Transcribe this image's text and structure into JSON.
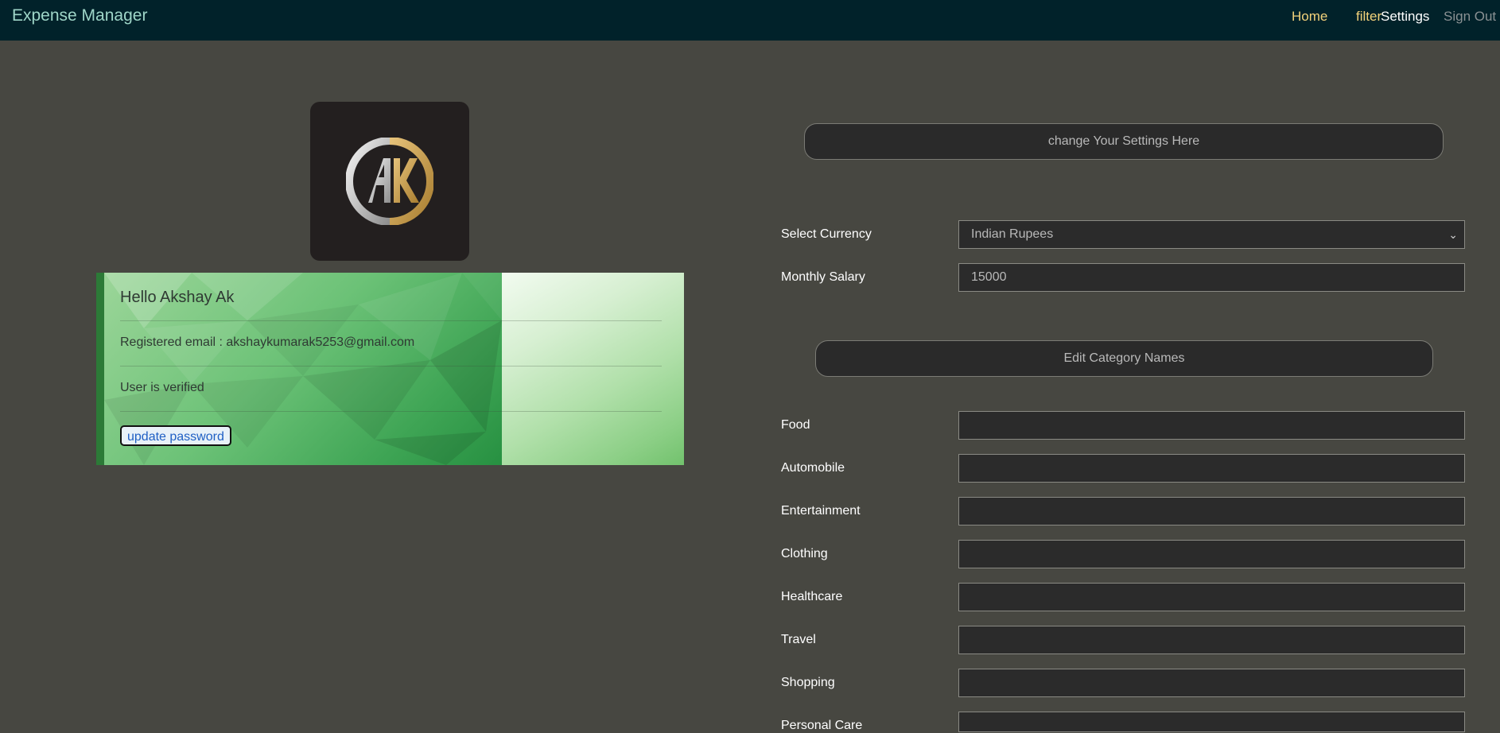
{
  "navbar": {
    "brand": "Expense Manager",
    "links": {
      "home": "Home",
      "filter": "filter",
      "settings": "Settings",
      "signout": "Sign Out"
    }
  },
  "profile": {
    "avatar_icon": "ak-logo",
    "greeting": "Hello Akshay Ak",
    "email_line": "Registered email : akshaykumarak5253@gmail.com",
    "status": "User is verified",
    "update_password": "update password"
  },
  "settings": {
    "header": "change Your Settings Here",
    "currency_label": "Select Currency",
    "currency_value": "Indian Rupees",
    "salary_label": "Monthly Salary",
    "salary_value": "15000",
    "category_header": "Edit Category Names",
    "categories": [
      {
        "label": "Food",
        "value": ""
      },
      {
        "label": "Automobile",
        "value": ""
      },
      {
        "label": "Entertainment",
        "value": ""
      },
      {
        "label": "Clothing",
        "value": ""
      },
      {
        "label": "Healthcare",
        "value": ""
      },
      {
        "label": "Travel",
        "value": ""
      },
      {
        "label": "Shopping",
        "value": ""
      },
      {
        "label": "Personal Care",
        "value": ""
      }
    ]
  },
  "colors": {
    "navbar_bg": "#01222a",
    "page_bg": "#474741",
    "nav_active": "#f3d27a"
  }
}
